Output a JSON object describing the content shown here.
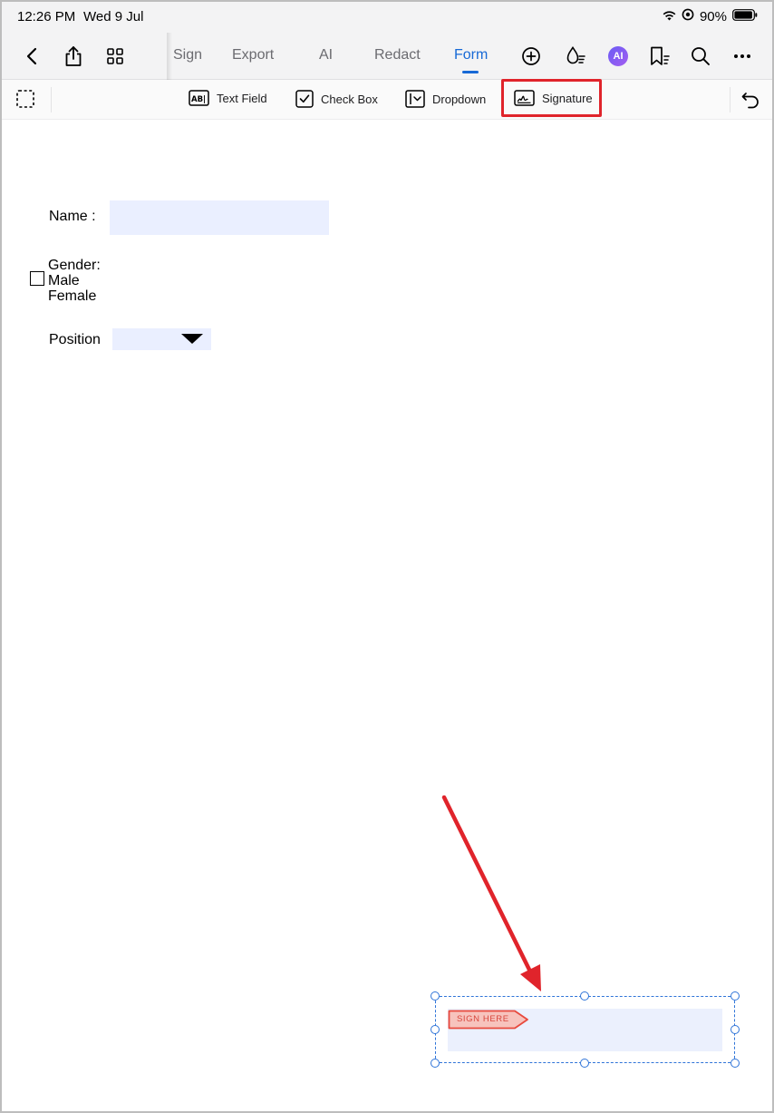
{
  "status_bar": {
    "time": "12:26 PM",
    "date": "Wed 9 Jul",
    "battery_percent": "90%",
    "icons": [
      "wifi-icon",
      "focus-icon",
      "battery-icon"
    ]
  },
  "top_nav": {
    "left_icons": [
      "back-icon",
      "share-icon",
      "grid-icon"
    ],
    "tabs": [
      {
        "label": "Sign",
        "active": false
      },
      {
        "label": "Export",
        "active": false
      },
      {
        "label": "AI",
        "active": false
      },
      {
        "label": "Redact",
        "active": false
      },
      {
        "label": "Form",
        "active": true
      }
    ],
    "ai_badge": "AI",
    "right_icons": [
      "add-circle-icon",
      "ink-drop-icon",
      "ai-badge-icon",
      "bookmark-list-icon",
      "search-icon",
      "more-icon"
    ]
  },
  "form_toolbar": {
    "tools": [
      {
        "name": "text-field",
        "label": "Text Field",
        "icon_glyph": "AB|"
      },
      {
        "name": "check-box",
        "label": "Check Box"
      },
      {
        "name": "dropdown",
        "label": "Dropdown"
      },
      {
        "name": "signature",
        "label": "Signature",
        "highlighted": true
      }
    ],
    "highlight_color": "#e0242b"
  },
  "document": {
    "name_label": "Name :",
    "gender_label": "Gender:",
    "male_label": "Male",
    "female_label": "Female",
    "position_label": "Position"
  },
  "signature_field": {
    "tag_text": "SIGN HERE",
    "tag_color": "#d8453b",
    "selection_color": "#2f74d8",
    "field_fill": "#ebf0fd"
  },
  "annotation": {
    "arrow_color": "#e0242b"
  },
  "colors": {
    "accent": "#1769d6",
    "field_fill": "#eaefff"
  }
}
